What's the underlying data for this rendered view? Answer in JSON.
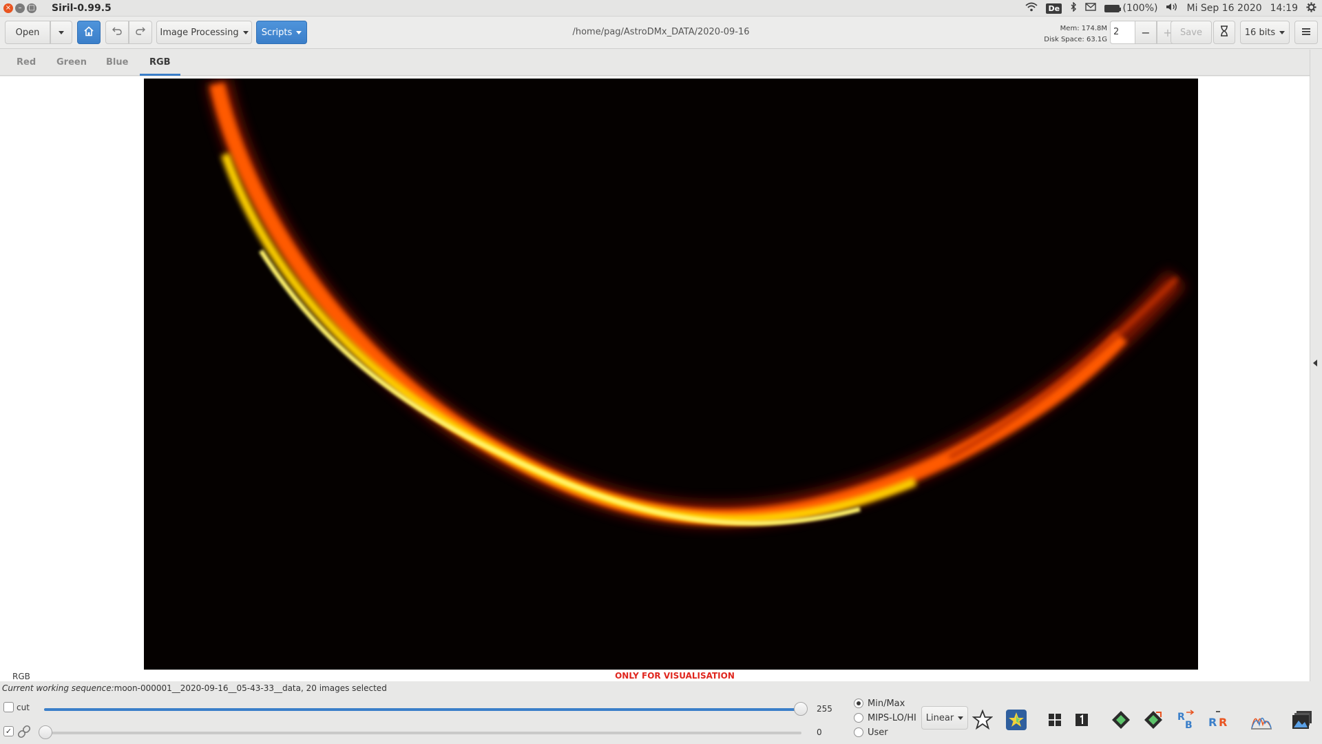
{
  "window": {
    "title": "Siril-0.99.5",
    "close_glyph": "×",
    "min_glyph": "–",
    "max_glyph": "□"
  },
  "tray": {
    "wifi_icon": "wifi-icon",
    "keyboard_layout": "De",
    "bluetooth_icon": "bluetooth-icon",
    "mail_icon": "mail-icon",
    "battery": "(100%)",
    "volume_icon": "volume-icon",
    "date": "Mi Sep 16 2020",
    "time": "14:19",
    "settings_icon": "gear-icon"
  },
  "toolbar": {
    "open_label": "Open",
    "image_processing_label": "Image Processing",
    "scripts_label": "Scripts",
    "path": "/home/pag/AstroDMx_DATA/2020-09-16",
    "mem": "Mem: 174.8M",
    "disk_space": "Disk Space: 63.1G",
    "threads_value": "2",
    "minus_glyph": "−",
    "plus_glyph": "+",
    "save_label": "Save",
    "bit_depth": "16 bits",
    "accent_color": "#3b7fc9"
  },
  "tabs": [
    {
      "label": "Red",
      "active": false
    },
    {
      "label": "Green",
      "active": false
    },
    {
      "label": "Blue",
      "active": false
    },
    {
      "label": "RGB",
      "active": true
    }
  ],
  "viewer": {
    "channel_label": "RGB",
    "visualisation_note": "ONLY FOR VISUALISATION"
  },
  "status": {
    "prefix": "Current working sequence:",
    "sequence": "moon-000001__2020-09-16__05-43-33__data, 20 images selected"
  },
  "levels": {
    "cut_label": "cut",
    "cut_checked": false,
    "link_checked": true,
    "hi_value": "255",
    "lo_value": "0",
    "hi_fraction": 1.0,
    "lo_fraction": 0.0
  },
  "scaling": {
    "options": [
      "Min/Max",
      "MIPS-LO/HI",
      "User"
    ],
    "selected": "Min/Max",
    "mode": "Linear"
  },
  "tools": [
    "auto-stretch-star-icon",
    "color-star-icon",
    "grid-icon",
    "single-frame-icon",
    "plate-solve-icon",
    "plate-solve-alt-icon",
    "rgb-align-icon",
    "rgb-compose-icon",
    "histogram-icon",
    "gallery-icon"
  ]
}
